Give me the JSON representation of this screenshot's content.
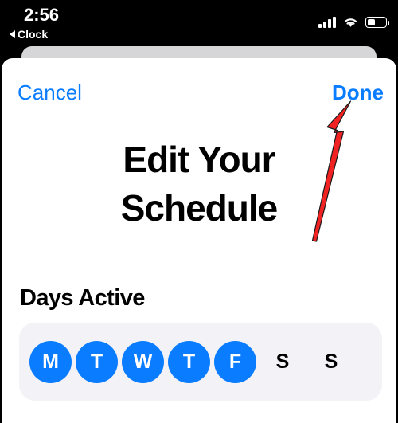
{
  "status_bar": {
    "time": "2:56",
    "back_label": "Clock",
    "back_icon": "left-triangle-icon",
    "signal_icon": "cellular-signal-icon",
    "wifi_icon": "wifi-icon",
    "battery_icon": "battery-icon",
    "battery_level_percent": 42
  },
  "sheet": {
    "toolbar": {
      "cancel_label": "Cancel",
      "done_label": "Done"
    },
    "title": "Edit Your Schedule",
    "days_section": {
      "heading": "Days Active",
      "days": [
        {
          "label": "M",
          "selected": true
        },
        {
          "label": "T",
          "selected": true
        },
        {
          "label": "W",
          "selected": true
        },
        {
          "label": "T",
          "selected": true
        },
        {
          "label": "F",
          "selected": true
        },
        {
          "label": "S",
          "selected": false
        },
        {
          "label": "S",
          "selected": false
        }
      ]
    }
  },
  "annotation": {
    "arrow_icon": "red-arrow-up-icon",
    "arrow_color": "#f02222",
    "points_to": "Done"
  },
  "colors": {
    "accent_blue": "#0a7cff",
    "sheet_background": "#ffffff",
    "back_sheet": "#d6d6d8",
    "pill_background": "#f2f2f7",
    "screen_background": "#000000",
    "text_primary": "#000000",
    "status_text": "#ffffff"
  }
}
